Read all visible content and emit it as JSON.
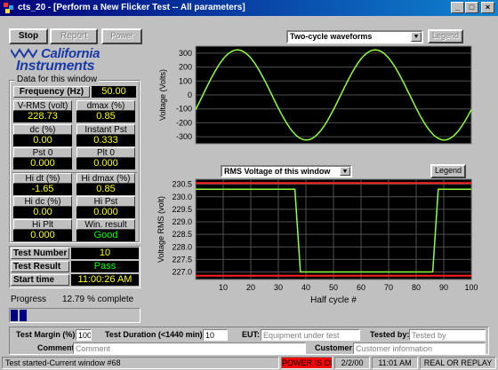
{
  "window": {
    "title": "cts_20 - [Perform a New Flicker Test -- All parameters]"
  },
  "toolbar": {
    "stop": "Stop",
    "report": "Report",
    "power": "Power"
  },
  "logo": {
    "line1": "California",
    "line2": "Instruments"
  },
  "data_group": {
    "title": "Data for this window"
  },
  "measurements": {
    "frequency": {
      "label": "Frequency (Hz)",
      "value": "50.00"
    },
    "vrms": {
      "label": "V-RMS (volt)",
      "value": "228.73"
    },
    "dmax": {
      "label": "dmax (%)",
      "value": "0.85"
    },
    "dc": {
      "label": "dc (%)",
      "value": "0.00"
    },
    "instant_pst": {
      "label": "Instant Pst",
      "value": "0.333"
    },
    "pst0": {
      "label": "Pst 0",
      "value": "0.000"
    },
    "plt0": {
      "label": "Plt 0",
      "value": "0.000"
    },
    "hi_dt": {
      "label": "Hi dt (%)",
      "value": "-1.65"
    },
    "hi_dmax": {
      "label": "Hi dmax (%)",
      "value": "0.85"
    },
    "hi_dc": {
      "label": "Hi dc (%)",
      "value": "0.00"
    },
    "hi_pst": {
      "label": "Hi Pst",
      "value": "0.000"
    },
    "hi_plt": {
      "label": "Hi Plt",
      "value": "0.000"
    },
    "win_result": {
      "label": "Win. result",
      "value": "Good"
    }
  },
  "test": {
    "number_label": "Test Number",
    "number_value": "10",
    "result_label": "Test Result",
    "result_value": "Pass",
    "start_label": "Start time",
    "start_value": "11:00:26 AM"
  },
  "progress": {
    "label": "Progress",
    "value": "12.79",
    "unit": "% complete",
    "fraction": 0.1279
  },
  "chart_top_controls": {
    "select": "Two-cycle waveforms",
    "legend": "Legend"
  },
  "chart_bottom_controls": {
    "select": "RMS Voltage of this window",
    "legend": "Legend"
  },
  "chart_data": [
    {
      "type": "line",
      "ylabel": "Voltage (Volts)",
      "xlabel": "",
      "ylim": [
        -350,
        350
      ],
      "yticks": [
        "300",
        "200",
        "100",
        "0",
        "-100",
        "-200",
        "-300"
      ],
      "series": [
        {
          "color": "#90ff40",
          "x": [
            0,
            0.25,
            0.5,
            0.75,
            1,
            1.25,
            1.5,
            1.75,
            2
          ],
          "y": [
            -105,
            323,
            105,
            -323,
            -105,
            323,
            105,
            -323,
            -105
          ]
        }
      ]
    },
    {
      "type": "line",
      "ylabel": "Voltage RMS (volt)",
      "xlabel": "Half cycle #",
      "xlim": [
        0,
        100
      ],
      "ylim": [
        226.7,
        230.7
      ],
      "xticks": [
        "10",
        "20",
        "30",
        "40",
        "50",
        "60",
        "70",
        "80",
        "90",
        "100"
      ],
      "yticks": [
        "230.5",
        "230.0",
        "229.5",
        "229.0",
        "228.5",
        "228.0",
        "227.5",
        "227.0"
      ],
      "limit_lines": [
        230.55,
        226.85
      ],
      "series": [
        {
          "color": "#90ff40",
          "x": [
            0,
            36,
            38,
            86,
            88,
            100
          ],
          "y": [
            230.3,
            230.3,
            227.0,
            227.0,
            230.3,
            230.3
          ]
        }
      ]
    }
  ],
  "footer": {
    "test_margin_label": "Test Margin (%):",
    "test_margin_value": "100",
    "test_duration_label": "Test Duration (<1440 min):",
    "test_duration_value": "10",
    "eut_label": "EUT:",
    "eut_placeholder": "Equipment under test",
    "tested_by_label": "Tested by:",
    "tested_by_placeholder": "Tested by",
    "comment_label": "Comment:",
    "comment_placeholder": "Comment",
    "customer_label": "Customer:",
    "customer_placeholder": "Customer information"
  },
  "statusbar": {
    "message": "Test started-Current window #68",
    "power": "POWER IS ON",
    "date": "2/2/00",
    "time": "11:01 AM",
    "mode": "REAL OR REPLAY"
  },
  "colors": {
    "accent": "#1a3aa8",
    "value_text": "#ffff00",
    "good_text": "#00ff00",
    "trace": "#90ff40",
    "limit": "#ff2020",
    "power_bg": "#ff0000"
  }
}
